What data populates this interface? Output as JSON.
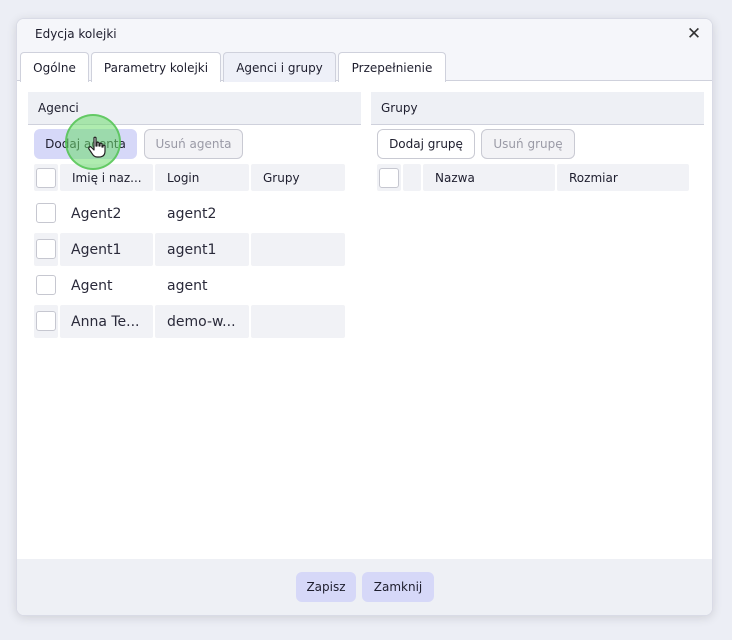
{
  "dialog": {
    "title": "Edycja kolejki",
    "close_icon": "close-icon"
  },
  "tabs": [
    {
      "label": "Ogólne"
    },
    {
      "label": "Parametry kolejki"
    },
    {
      "label": "Agenci i grupy",
      "active": true
    },
    {
      "label": "Przepełnienie"
    }
  ],
  "agents": {
    "header": "Agenci",
    "add_label": "Dodaj agenta",
    "remove_label": "Usuń agenta",
    "columns": [
      "Imię i naz...",
      "Login",
      "Grupy"
    ],
    "rows": [
      {
        "name": "Agent2",
        "login": "agent2",
        "groups": ""
      },
      {
        "name": "Agent1",
        "login": "agent1",
        "groups": ""
      },
      {
        "name": "Agent",
        "login": "agent",
        "groups": ""
      },
      {
        "name": "Anna Te...",
        "login": "demo-w...",
        "groups": ""
      }
    ]
  },
  "groups": {
    "header": "Grupy",
    "add_label": "Dodaj grupę",
    "remove_label": "Usuń grupę",
    "columns": [
      "Nazwa",
      "Rozmiar"
    ]
  },
  "footer": {
    "save_label": "Zapisz",
    "close_label": "Zamknij"
  },
  "colors": {
    "accent": "#d6d8f8",
    "click_highlight": "#6edc6e"
  }
}
